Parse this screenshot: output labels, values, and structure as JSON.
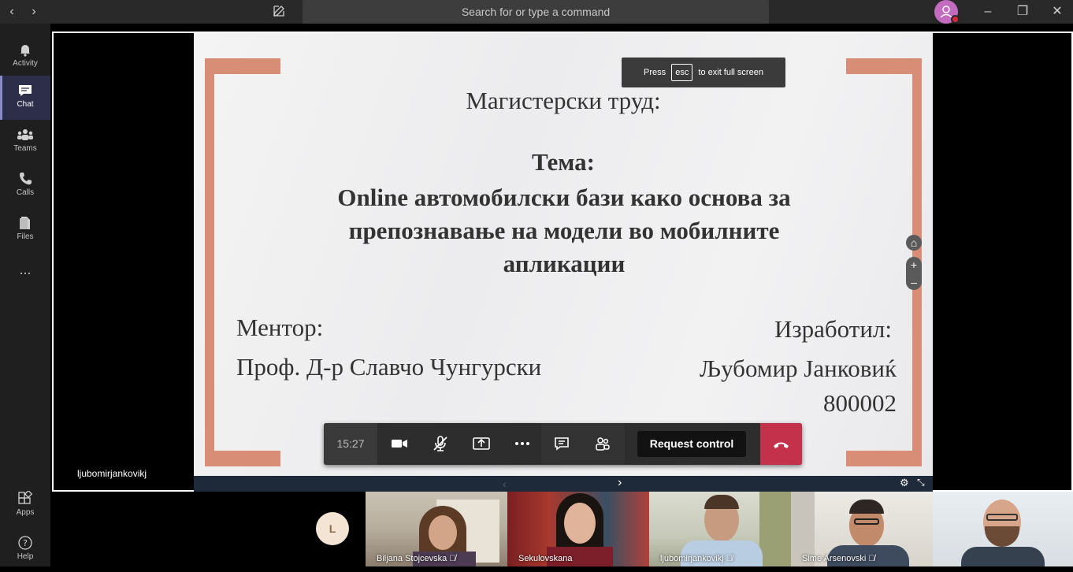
{
  "titlebar": {
    "search_placeholder": "Search for or type a command"
  },
  "rail": {
    "items": [
      {
        "label": "Activity"
      },
      {
        "label": "Chat"
      },
      {
        "label": "Teams"
      },
      {
        "label": "Calls"
      },
      {
        "label": "Files"
      },
      {
        "label": "..."
      }
    ],
    "apps_label": "Apps",
    "help_label": "Help"
  },
  "toast": {
    "press": "Press",
    "key": "esc",
    "rest": "to exit full screen"
  },
  "slide": {
    "title": "Магистерски труд:",
    "tema": "Тема:",
    "topic_line1": "Online автомобилски бази како основа за",
    "topic_line2": "препознавање на модели во мобилните",
    "topic_line3": "апликации",
    "mentor_label": "Ментор:",
    "mentor_name": "Проф. Д-р Славчо Чунгурски",
    "author_label": "Изработил:",
    "author_name": "Љубомир Јанковиќ",
    "index": "800002"
  },
  "callbar": {
    "timer": "15:27",
    "request_control": "Request control"
  },
  "presenter": "ljubomirjankovikj",
  "participants": [
    {
      "initial": "L"
    },
    {
      "name": "Biljana Stojcevska"
    },
    {
      "name": "Sekulovskana"
    },
    {
      "name": "ljubomirjankovikj"
    },
    {
      "name": "Sime Arsenovski"
    },
    {
      "name": ""
    }
  ],
  "colors": {
    "accent": "#6264a7",
    "bracket": "#d88e76",
    "hangup": "#c4314b"
  }
}
